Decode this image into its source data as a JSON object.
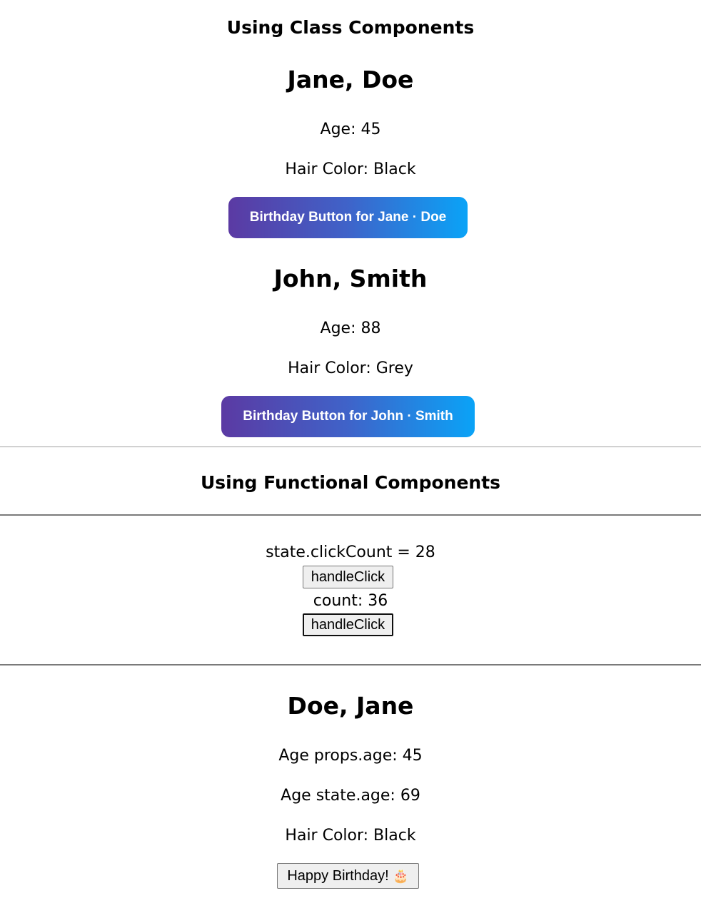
{
  "class_section": {
    "title": "Using Class Components",
    "people": [
      {
        "name": "Jane, Doe",
        "age": "Age: 45",
        "hair": "Hair Color: Black",
        "button": "Birthday Button for Jane · Doe"
      },
      {
        "name": "John, Smith",
        "age": "Age: 88",
        "hair": "Hair Color: Grey",
        "button": "Birthday Button for John · Smith"
      }
    ]
  },
  "functional_section": {
    "title": "Using Functional Components",
    "counter": {
      "state_label": "state.clickCount = 28",
      "button1": "handleClick",
      "count_label": "count: 36",
      "button2": "handleClick"
    },
    "person": {
      "name": "Doe, Jane",
      "age_props": "Age props.age: 45",
      "age_state": "Age state.age: 69",
      "hair": "Hair Color: Black",
      "button": "Happy Birthday!",
      "button_icon": "cake-icon"
    }
  },
  "colors": {
    "gradient_start": "#5b3aa3",
    "gradient_end": "#0aa3f7"
  }
}
